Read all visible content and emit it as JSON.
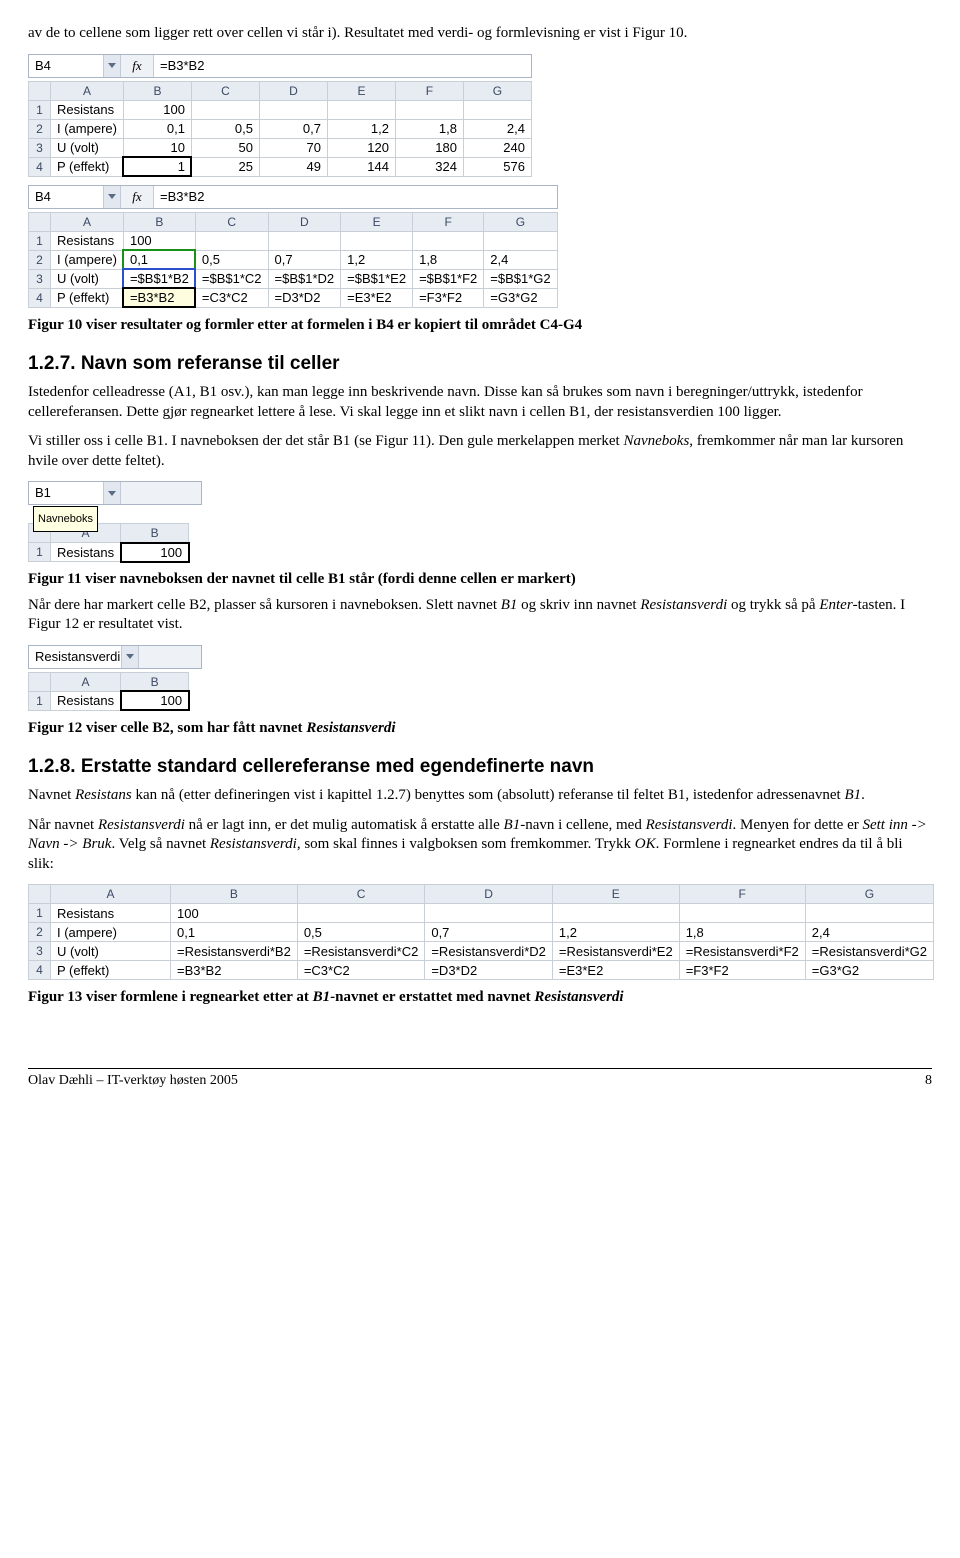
{
  "intro": "av de to cellene som ligger rett over cellen vi står i). Resultatet med verdi- og formlevisning er vist i Figur 10.",
  "fig10": {
    "top": {
      "namebox": "B4",
      "formula": "=B3*B2",
      "colhdr": [
        "",
        "A",
        "B",
        "C",
        "D",
        "E",
        "F",
        "G"
      ],
      "rows": [
        [
          "1",
          "Resistans",
          "100",
          "",
          "",
          "",
          "",
          ""
        ],
        [
          "2",
          "I (ampere)",
          "0,1",
          "0,5",
          "0,7",
          "1,2",
          "1,8",
          "2,4"
        ],
        [
          "3",
          "U (volt)",
          "10",
          "50",
          "70",
          "120",
          "180",
          "240"
        ],
        [
          "4",
          "P (effekt)",
          "1",
          "25",
          "49",
          "144",
          "324",
          "576"
        ]
      ]
    },
    "bottom": {
      "namebox": "B4",
      "formula": "=B3*B2",
      "colhdr": [
        "",
        "A",
        "B",
        "C",
        "D",
        "E",
        "F",
        "G"
      ],
      "rows": [
        [
          "1",
          "Resistans",
          "100",
          "",
          "",
          "",
          "",
          ""
        ],
        [
          "2",
          "I (ampere)",
          "0,1",
          "0,5",
          "0,7",
          "1,2",
          "1,8",
          "2,4"
        ],
        [
          "3",
          "U (volt)",
          "=$B$1*B2",
          "=$B$1*C2",
          "=$B$1*D2",
          "=$B$1*E2",
          "=$B$1*F2",
          "=$B$1*G2"
        ],
        [
          "4",
          "P (effekt)",
          "=B3*B2",
          "=C3*C2",
          "=D3*D2",
          "=E3*E2",
          "=F3*F2",
          "=G3*G2"
        ]
      ]
    },
    "caption": "Figur 10 viser resultater og formler etter at formelen i B4 er kopiert til området C4-G4"
  },
  "sec127": {
    "heading": "1.2.7.   Navn som referanse til celler",
    "p1a": "Istedenfor celleadresse (A1, B1 osv.), kan man legge inn beskrivende navn. Disse kan så brukes som navn i beregninger/uttrykk, istedenfor cellereferansen. Dette gjør regnearket lettere å lese. Vi skal legge inn et slikt navn i cellen B1, der resistansverdien 100 ligger.",
    "p2a": "Vi stiller oss i celle B1. I navneboksen der det står B1 (se Figur 11). Den gule merkelappen merket ",
    "p2b": "Navneboks",
    "p2c": ", fremkommer når man lar kursoren hvile over dette feltet)."
  },
  "fig11": {
    "namebox": "B1",
    "tooltip": "Navneboks",
    "colhdr": [
      "",
      "A",
      "B"
    ],
    "rows": [
      [
        "1",
        "Resistans",
        "100"
      ]
    ],
    "caption": "Figur 11 viser navneboksen der navnet til celle B1 står (fordi denne cellen er markert)",
    "p_after_a": "Når dere har markert celle B2, plasser så kursoren i navneboksen. Slett navnet ",
    "p_after_b": "B1",
    "p_after_c": " og skriv inn navnet ",
    "p_after_d": "Resistansverdi",
    "p_after_e": " og trykk så på ",
    "p_after_f": "Enter",
    "p_after_g": "-tasten. I Figur 12 er resultatet vist."
  },
  "fig12": {
    "namebox": "Resistansverdi",
    "colhdr": [
      "",
      "A",
      "B"
    ],
    "rows": [
      [
        "1",
        "Resistans",
        "100"
      ]
    ],
    "caption_a": "Figur 12 viser celle B2, som har fått navnet ",
    "caption_b": "Resistansverdi"
  },
  "sec128": {
    "heading": "1.2.8.   Erstatte standard cellereferanse med egendefinerte navn",
    "p1a": "Navnet ",
    "p1b": "Resistans",
    "p1c": " kan nå (etter defineringen vist i kapittel 1.2.7) benyttes som (absolutt) referanse til feltet B1, istedenfor adressenavnet ",
    "p1d": "B1",
    "p1e": ".",
    "p2a": "Når navnet ",
    "p2b": "Resistansverdi",
    "p2c": " nå er lagt inn, er det mulig automatisk å erstatte alle ",
    "p2d": "B1",
    "p2e": "-navn i cellene, med ",
    "p2f": "Resistansverdi",
    "p2g": ". Menyen for dette er ",
    "p2h": "Sett inn -> Navn -> Bruk",
    "p2i": ". Velg så navnet ",
    "p2j": "Resistansverdi",
    "p2k": ", som skal finnes i valgboksen som fremkommer. Trykk ",
    "p2l": "OK",
    "p2m": ". Formlene i regnearket endres da til å bli slik:"
  },
  "fig13": {
    "colhdr": [
      "",
      "A",
      "B",
      "C",
      "D",
      "E",
      "F",
      "G"
    ],
    "rows": [
      [
        "1",
        "Resistans",
        "100",
        "",
        "",
        "",
        "",
        ""
      ],
      [
        "2",
        "I (ampere)",
        "0,1",
        "0,5",
        "0,7",
        "1,2",
        "1,8",
        "2,4"
      ],
      [
        "3",
        "U (volt)",
        "=Resistansverdi*B2",
        "=Resistansverdi*C2",
        "=Resistansverdi*D2",
        "=Resistansverdi*E2",
        "=Resistansverdi*F2",
        "=Resistansverdi*G2"
      ],
      [
        "4",
        "P (effekt)",
        "=B3*B2",
        "=C3*C2",
        "=D3*D2",
        "=E3*E2",
        "=F3*F2",
        "=G3*G2"
      ]
    ],
    "caption_a": "Figur 13 viser formlene i regnearket etter at ",
    "caption_b": "B1",
    "caption_c": "-navnet er erstattet med navnet ",
    "caption_d": "Resistansverdi"
  },
  "footer": {
    "left": "Olav Dæhli – IT-verktøy høsten 2005",
    "right": "8"
  },
  "fx_label": "fx"
}
